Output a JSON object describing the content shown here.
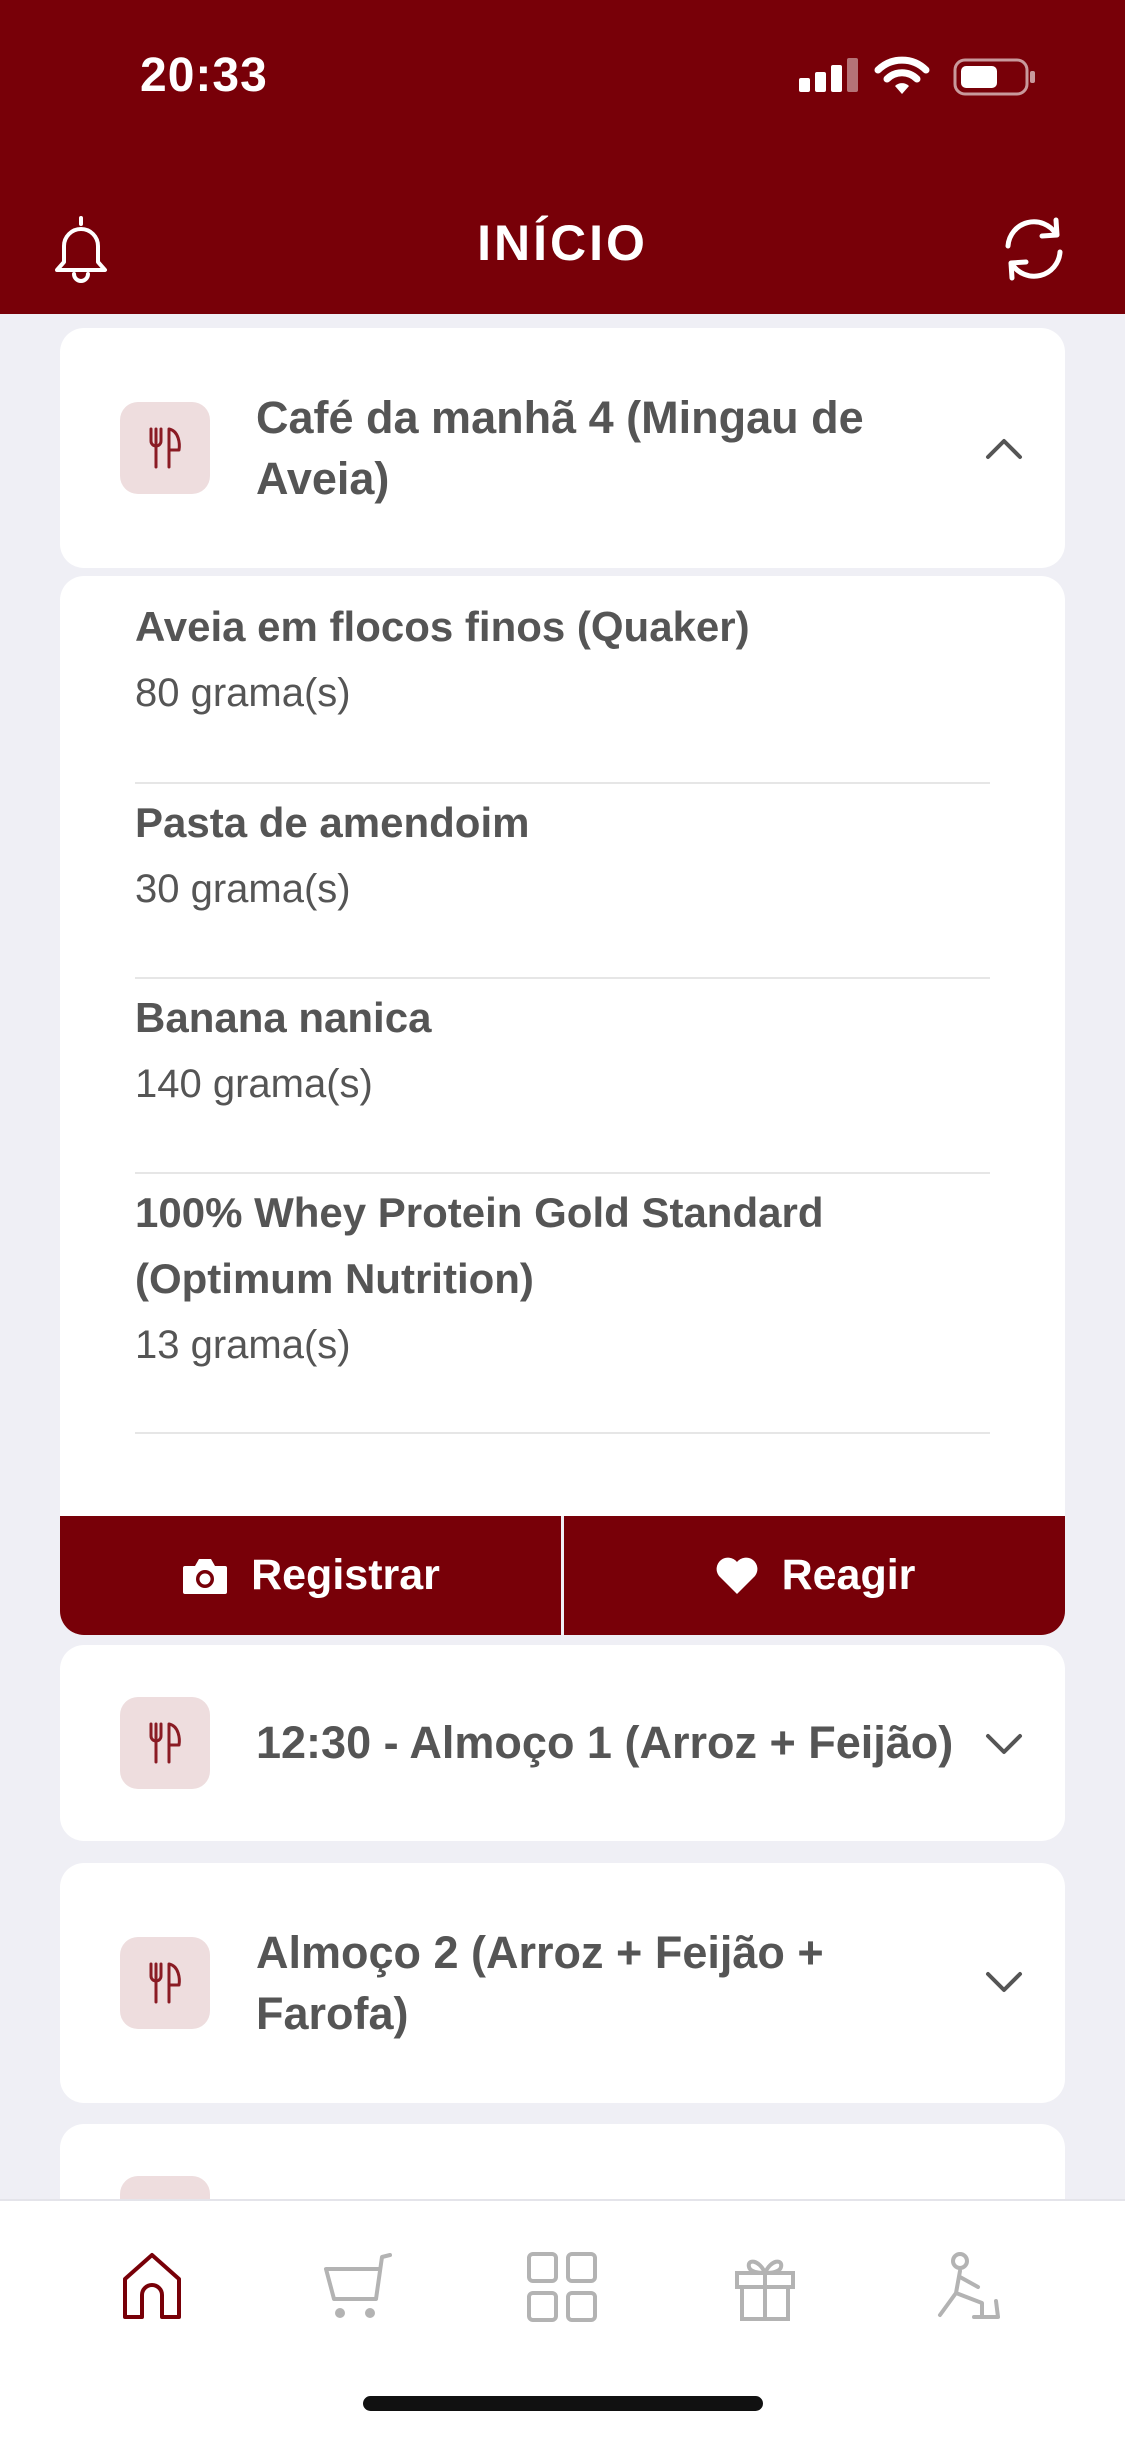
{
  "status_bar": {
    "time": "20:33"
  },
  "header": {
    "title": "INÍCIO"
  },
  "meals": [
    {
      "title": "Café da manhã 4 (Mingau de Aveia)",
      "expanded": true,
      "foods": [
        {
          "name": "Aveia em flocos finos (Quaker)",
          "quantity": "80 grama(s)"
        },
        {
          "name": "Pasta de amendoim",
          "quantity": "30 grama(s)"
        },
        {
          "name": "Banana nanica",
          "quantity": "140 grama(s)"
        },
        {
          "name": "100% Whey Protein Gold Standard (Optimum Nutrition)",
          "quantity": "13 grama(s)"
        }
      ],
      "actions": {
        "register_label": "Registrar",
        "react_label": "Reagir"
      }
    },
    {
      "title": "12:30 - Almoço 1 (Arroz + Feijão)",
      "expanded": false
    },
    {
      "title": "Almoço 2 (Arroz + Feijão + Farofa)",
      "expanded": false
    }
  ],
  "bottom_nav": {
    "items": [
      {
        "icon": "home-icon",
        "active": true
      },
      {
        "icon": "cart-icon",
        "active": false
      },
      {
        "icon": "grid-icon",
        "active": false
      },
      {
        "icon": "gift-icon",
        "active": false
      },
      {
        "icon": "exercise-icon",
        "active": false
      }
    ]
  },
  "colors": {
    "brand": "#780008",
    "background": "#efeff5",
    "icon_box": "#eeddde",
    "text": "#555555",
    "inactive_icon": "#b3b3b3"
  }
}
